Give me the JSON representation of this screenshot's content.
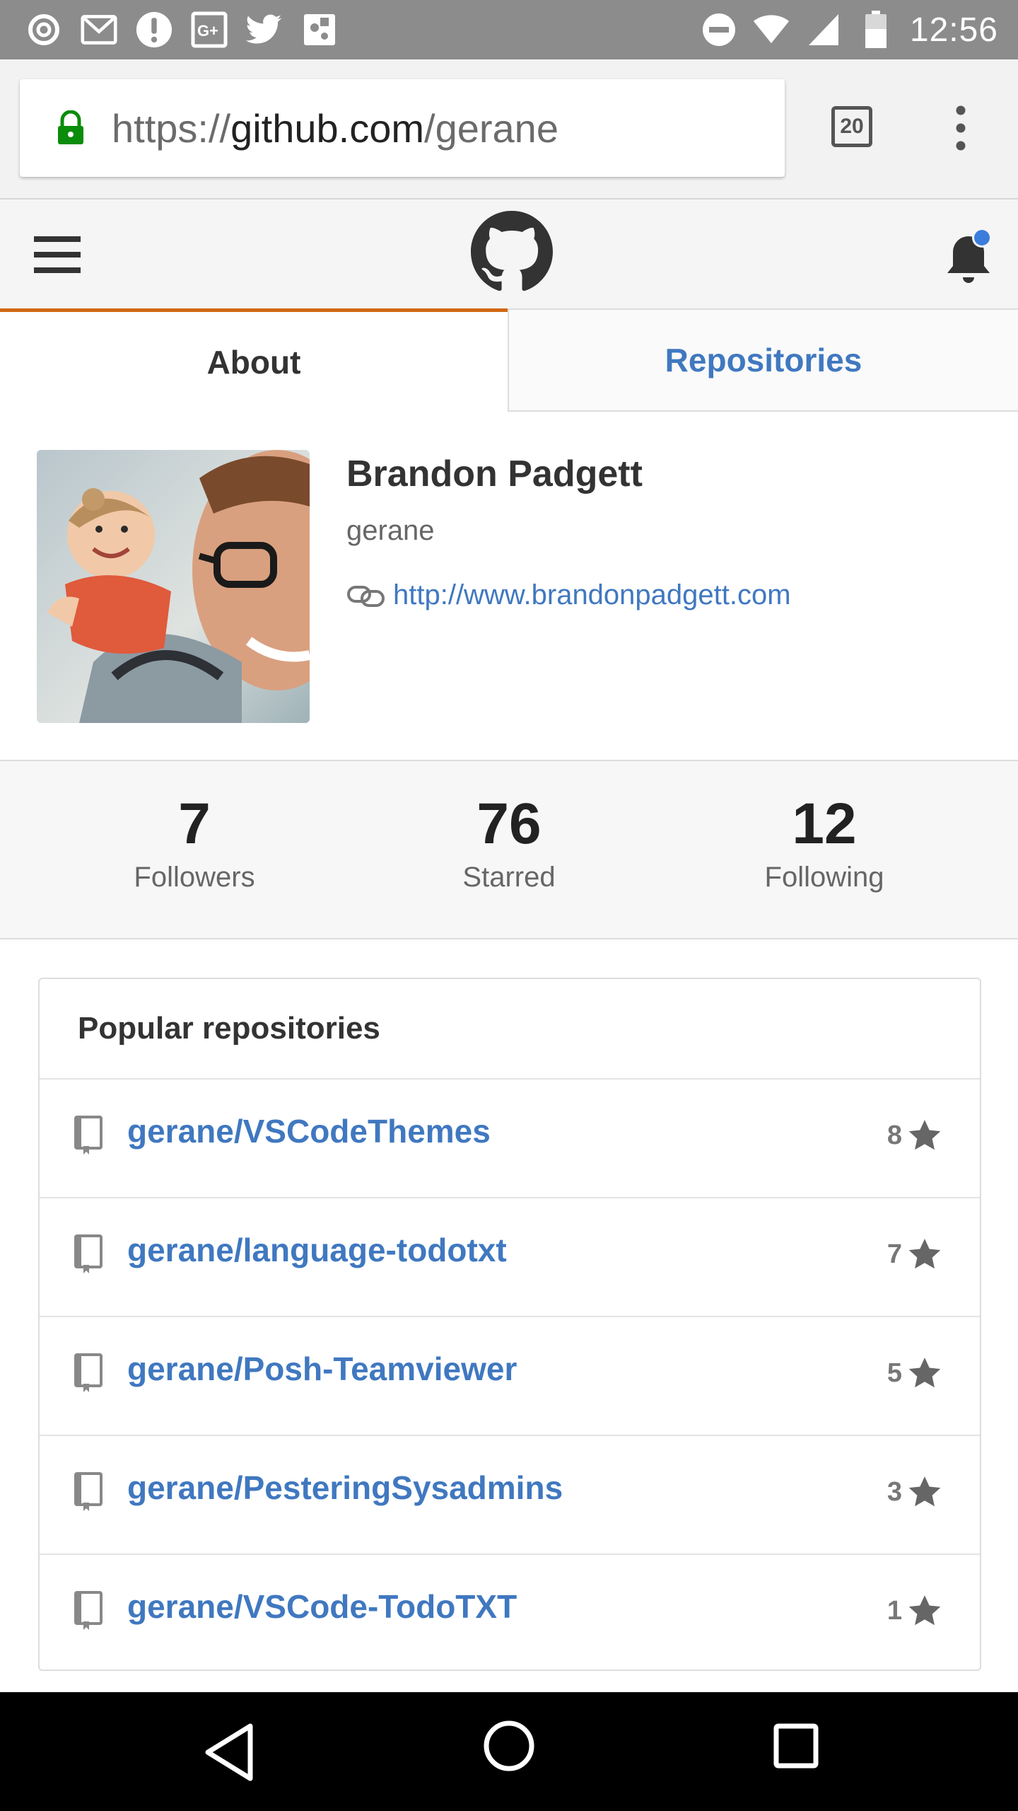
{
  "status_bar": {
    "time": "12:56",
    "icons": [
      "sync-icon",
      "gmail-icon",
      "alert-icon",
      "google-plus-icon",
      "twitter-icon",
      "puzzle-icon",
      "dnd-icon",
      "wifi-icon",
      "signal-icon",
      "battery-icon"
    ]
  },
  "browser": {
    "url_scheme": "https://",
    "url_host": "github.com",
    "url_path": "/gerane",
    "tab_count": "20"
  },
  "tabs": {
    "about": "About",
    "repositories": "Repositories"
  },
  "profile": {
    "name": "Brandon Padgett",
    "login": "gerane",
    "website": "http://www.brandonpadgett.com"
  },
  "stats": [
    {
      "value": "7",
      "label": "Followers"
    },
    {
      "value": "76",
      "label": "Starred"
    },
    {
      "value": "12",
      "label": "Following"
    }
  ],
  "popular": {
    "heading": "Popular repositories",
    "repos": [
      {
        "name": "gerane/VSCodeThemes",
        "stars": "8"
      },
      {
        "name": "gerane/language-todotxt",
        "stars": "7"
      },
      {
        "name": "gerane/Posh-Teamviewer",
        "stars": "5"
      },
      {
        "name": "gerane/PesteringSysadmins",
        "stars": "3"
      },
      {
        "name": "gerane/VSCode-TodoTXT",
        "stars": "1"
      }
    ]
  },
  "colors": {
    "link_blue": "#4078c0",
    "tab_accent": "#d26911",
    "status_bar": "#8c8c8c",
    "notification_dot": "#3b7ddd"
  }
}
